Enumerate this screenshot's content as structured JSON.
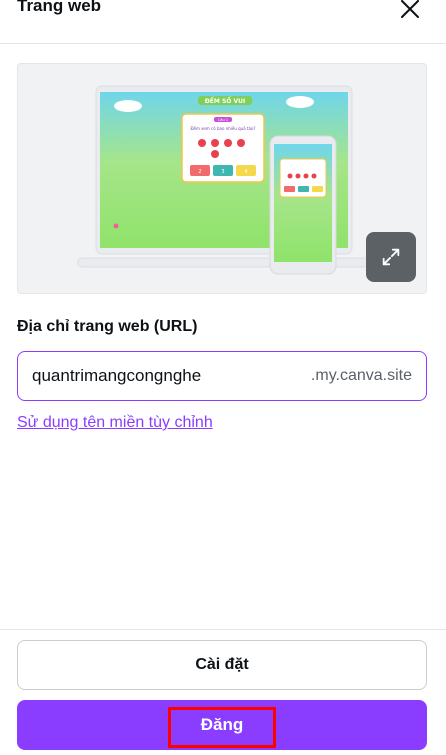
{
  "header": {
    "title": "Trang web",
    "close_icon": "close-icon"
  },
  "preview": {
    "site_title": "ĐẾM SỐ VUI",
    "question": "Đếm xem có bao nhiêu quả táo?",
    "badge": "Câu 1",
    "answers": [
      "2",
      "3",
      "4"
    ],
    "expand_icon": "expand-icon"
  },
  "url": {
    "label": "Địa chỉ trang web (URL)",
    "value": "quantrimangcongnghe",
    "suffix": ".my.canva.site"
  },
  "custom_domain_link": "Sử dụng tên miền tùy chỉnh",
  "buttons": {
    "settings": "Cài đặt",
    "publish": "Đăng"
  },
  "colors": {
    "accent": "#8b3dff",
    "highlight": "#ff0000"
  }
}
